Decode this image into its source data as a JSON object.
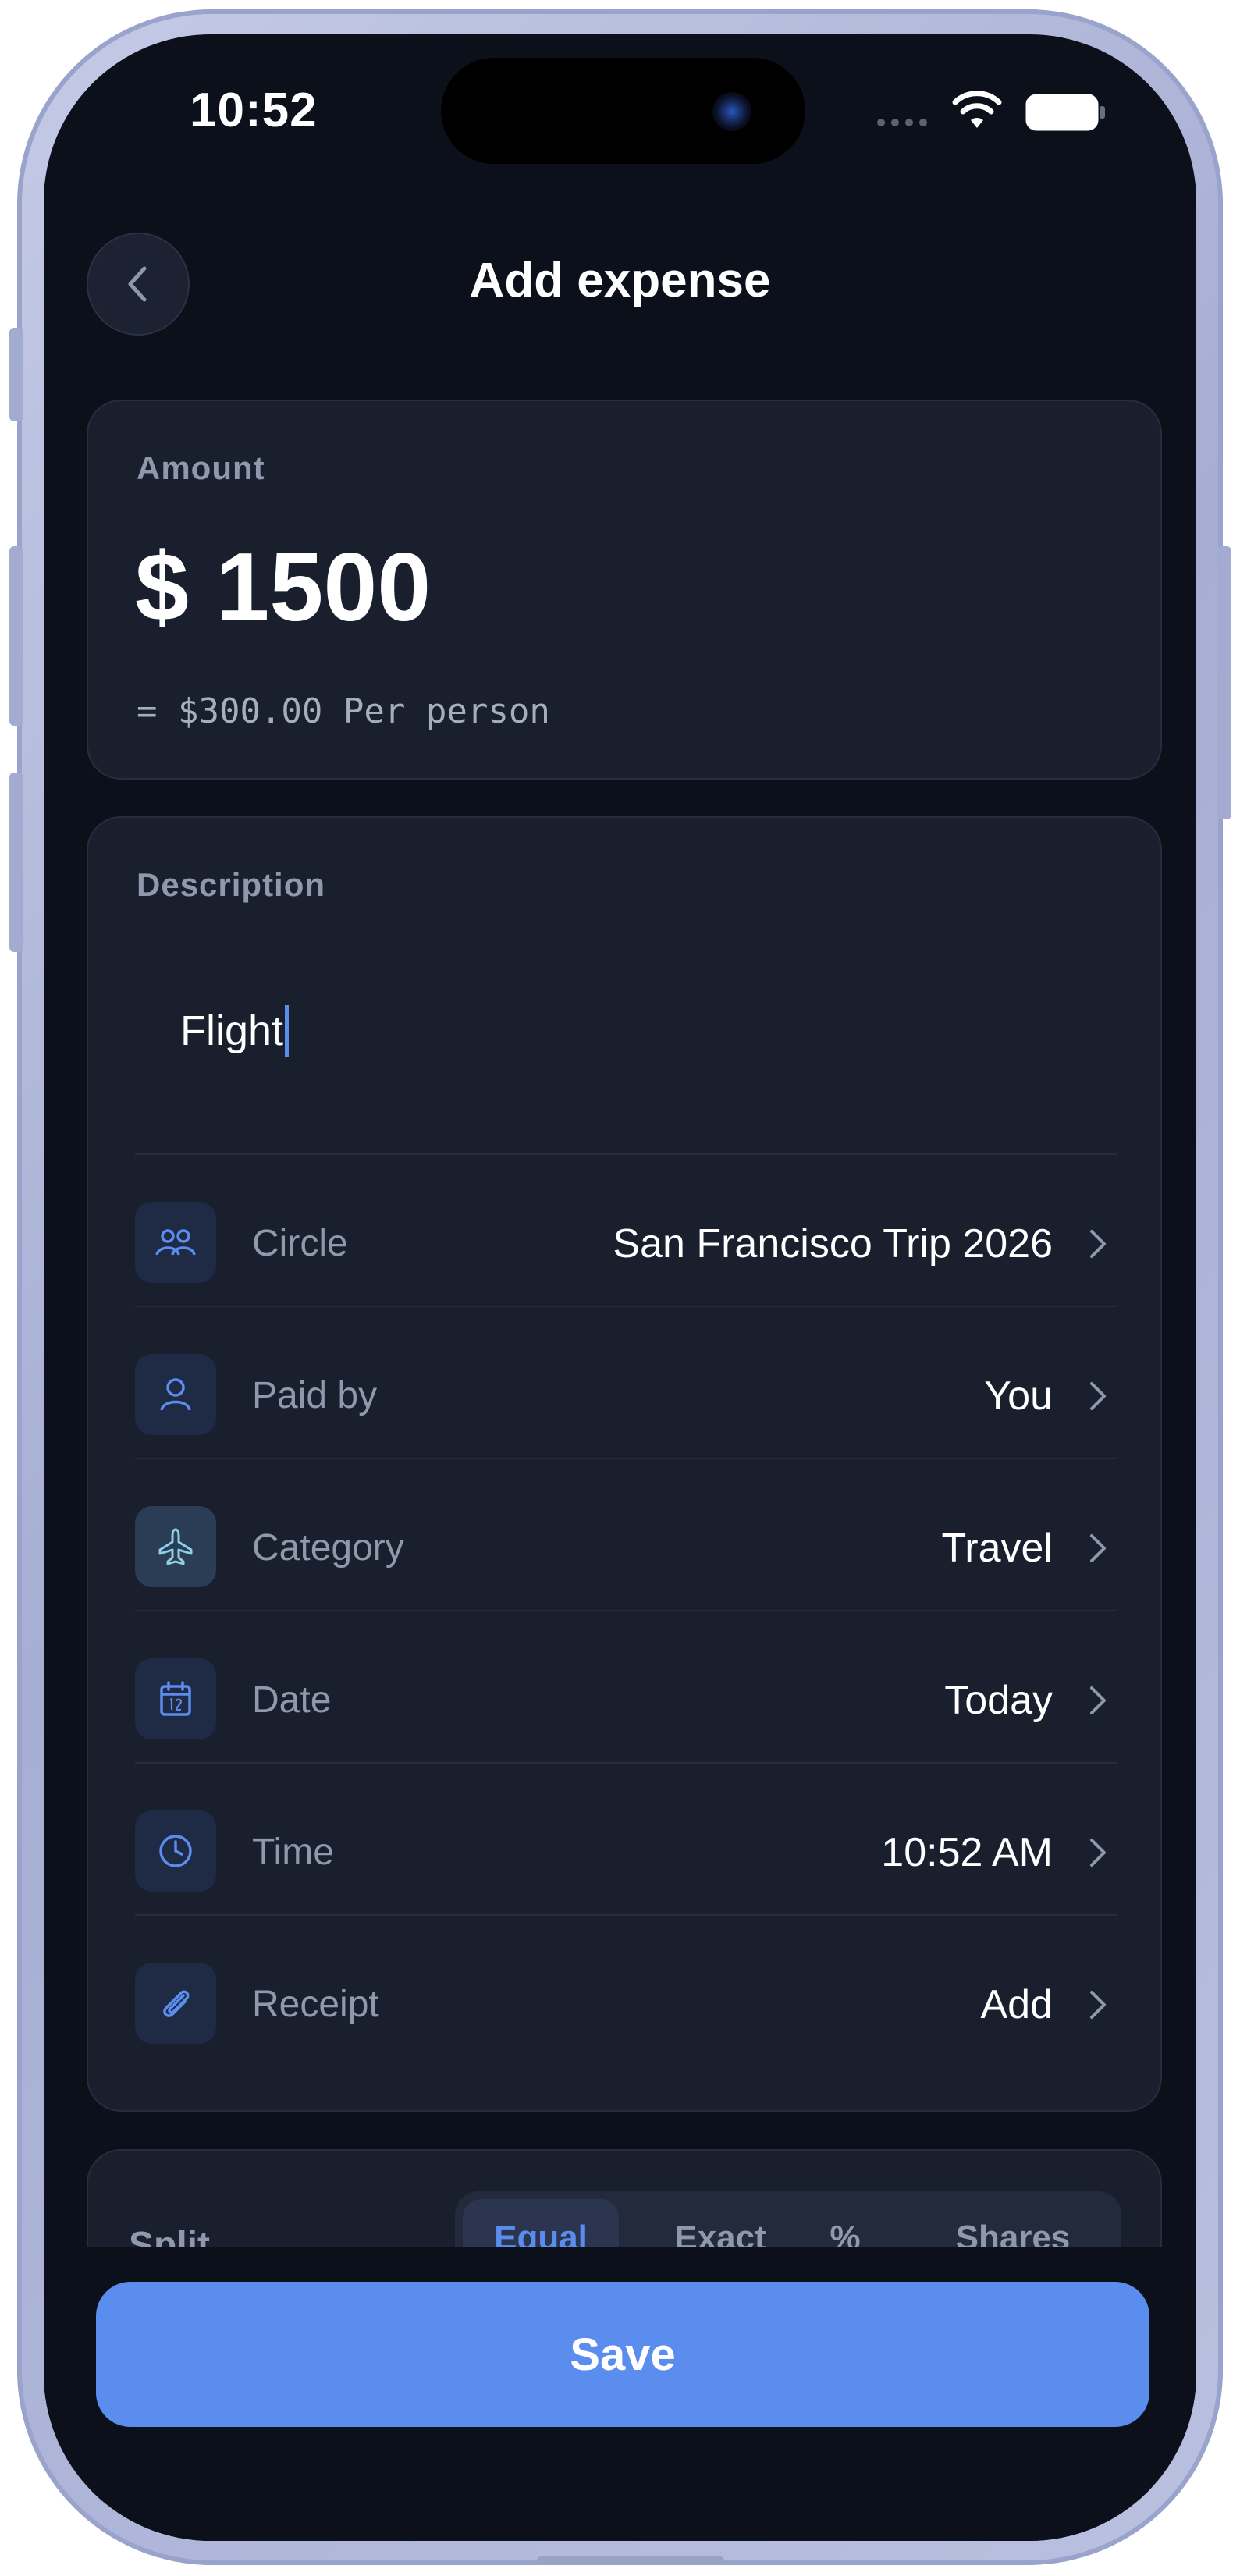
{
  "status_bar": {
    "time": "10:52"
  },
  "header": {
    "title": "Add expense"
  },
  "amount_card": {
    "label": "Amount",
    "value": "$ 1500",
    "per_person": "= $300.00 Per person"
  },
  "description_card": {
    "label": "Description",
    "input_value": "Flight"
  },
  "rows": [
    {
      "label": "Circle",
      "value": "San Francisco Trip 2026",
      "icon": "group-icon"
    },
    {
      "label": "Paid by",
      "value": "You",
      "icon": "user-icon"
    },
    {
      "label": "Category",
      "value": "Travel",
      "icon": "airplane-icon"
    },
    {
      "label": "Date",
      "value": "Today",
      "icon": "calendar-icon"
    },
    {
      "label": "Time",
      "value": "10:52 AM",
      "icon": "clock-icon"
    },
    {
      "label": "Receipt",
      "value": "Add",
      "icon": "paperclip-icon"
    }
  ],
  "split_card": {
    "label": "Split",
    "options": [
      "Equal",
      "Exact",
      "%",
      "Shares"
    ],
    "selected": "Equal"
  },
  "save_button": {
    "label": "Save"
  },
  "colors": {
    "accent": "#5b8def",
    "background": "#0b101b",
    "card": "#1a1f2e"
  }
}
